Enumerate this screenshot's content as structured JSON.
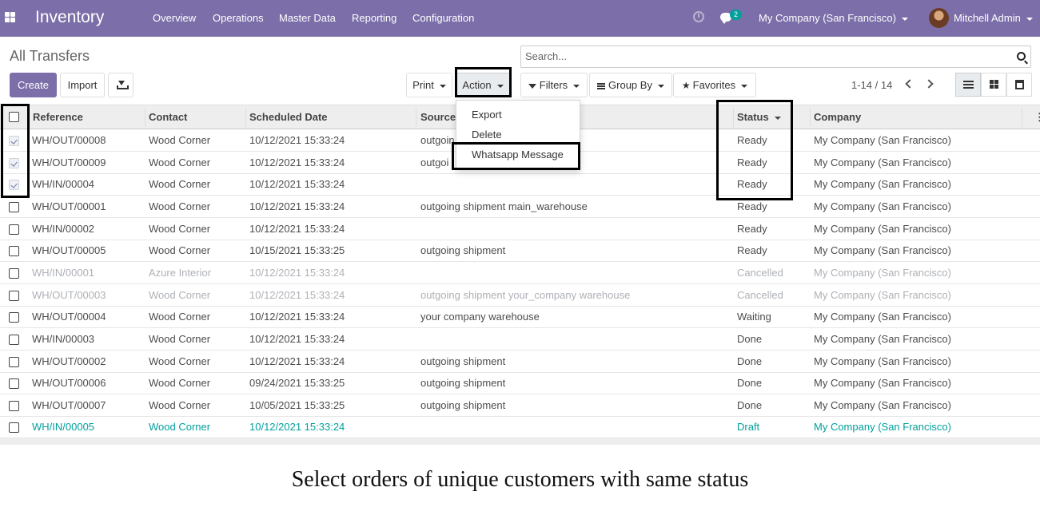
{
  "navbar": {
    "app_name": "Inventory",
    "menu": [
      "Overview",
      "Operations",
      "Master Data",
      "Reporting",
      "Configuration"
    ],
    "chat_badge": "2",
    "company": "My Company (San Francisco)",
    "user": "Mitchell Admin",
    "icons": [
      "apps-grid-icon",
      "clock-icon",
      "chat-icon",
      "user-avatar"
    ]
  },
  "control_panel": {
    "title": "All Transfers",
    "create_label": "Create",
    "import_label": "Import",
    "print_label": "Print",
    "action_label": "Action",
    "search_placeholder": "Search...",
    "filters_label": "Filters",
    "groupby_label": "Group By",
    "favorites_label": "Favorites",
    "pager": "1-14 / 14"
  },
  "action_menu": [
    "Export",
    "Delete",
    "Whatsapp Message"
  ],
  "table": {
    "columns": [
      "Reference",
      "Contact",
      "Scheduled Date",
      "Source",
      "Status",
      "Company"
    ],
    "rows": [
      {
        "checked": true,
        "style": "dark",
        "ref": "WH/OUT/00008",
        "contact": "Wood Corner",
        "date": "10/12/2021 15:33:24",
        "source": "outgoin",
        "status": "Ready",
        "company": "My Company (San Francisco)"
      },
      {
        "checked": true,
        "style": "dark",
        "ref": "WH/OUT/00009",
        "contact": "Wood Corner",
        "date": "10/12/2021 15:33:24",
        "source": "outgoi",
        "status": "Ready",
        "company": "My Company (San Francisco)"
      },
      {
        "checked": true,
        "style": "dark",
        "ref": "WH/IN/00004",
        "contact": "Wood Corner",
        "date": "10/12/2021 15:33:24",
        "source": "",
        "status": "Ready",
        "company": "My Company (San Francisco)"
      },
      {
        "checked": false,
        "style": "dark",
        "ref": "WH/OUT/00001",
        "contact": "Wood Corner",
        "date": "10/12/2021 15:33:24",
        "source": "outgoing shipment main_warehouse",
        "status": "Ready",
        "company": "My Company (San Francisco)"
      },
      {
        "checked": false,
        "style": "dark",
        "ref": "WH/IN/00002",
        "contact": "Wood Corner",
        "date": "10/12/2021 15:33:24",
        "source": "",
        "status": "Ready",
        "company": "My Company (San Francisco)"
      },
      {
        "checked": false,
        "style": "dark",
        "ref": "WH/OUT/00005",
        "contact": "Wood Corner",
        "date": "10/15/2021 15:33:25",
        "source": "outgoing shipment",
        "status": "Ready",
        "company": "My Company (San Francisco)"
      },
      {
        "checked": false,
        "style": "muted",
        "ref": "WH/IN/00001",
        "contact": "Azure Interior",
        "date": "10/12/2021 15:33:24",
        "source": "",
        "status": "Cancelled",
        "company": "My Company (San Francisco)"
      },
      {
        "checked": false,
        "style": "muted",
        "ref": "WH/OUT/00003",
        "contact": "Wood Corner",
        "date": "10/12/2021 15:33:24",
        "source": "outgoing shipment your_company warehouse",
        "status": "Cancelled",
        "company": "My Company (San Francisco)"
      },
      {
        "checked": false,
        "style": "dark",
        "ref": "WH/OUT/00004",
        "contact": "Wood Corner",
        "date": "10/12/2021 15:33:24",
        "source": "your company warehouse",
        "status": "Waiting",
        "company": "My Company (San Francisco)"
      },
      {
        "checked": false,
        "style": "dark",
        "ref": "WH/IN/00003",
        "contact": "Wood Corner",
        "date": "10/12/2021 15:33:24",
        "source": "",
        "status": "Done",
        "company": "My Company (San Francisco)"
      },
      {
        "checked": false,
        "style": "dark",
        "ref": "WH/OUT/00002",
        "contact": "Wood Corner",
        "date": "10/12/2021 15:33:24",
        "source": "outgoing shipment",
        "status": "Done",
        "company": "My Company (San Francisco)"
      },
      {
        "checked": false,
        "style": "dark",
        "ref": "WH/OUT/00006",
        "contact": "Wood Corner",
        "date": "09/24/2021 15:33:25",
        "source": "outgoing shipment",
        "status": "Done",
        "company": "My Company (San Francisco)"
      },
      {
        "checked": false,
        "style": "dark",
        "ref": "WH/OUT/00007",
        "contact": "Wood Corner",
        "date": "10/05/2021 15:33:25",
        "source": "outgoing shipment",
        "status": "Done",
        "company": "My Company (San Francisco)"
      },
      {
        "checked": false,
        "style": "teal",
        "ref": "WH/IN/00005",
        "contact": "Wood Corner",
        "date": "10/12/2021 15:33:24",
        "source": "",
        "status": "Draft",
        "company": "My Company (San Francisco)"
      }
    ]
  },
  "caption": "Select orders of unique customers with same status",
  "colors": {
    "navbar": "#7c6fa9",
    "teal": "#00a09d",
    "muted": "#adb1b6"
  }
}
